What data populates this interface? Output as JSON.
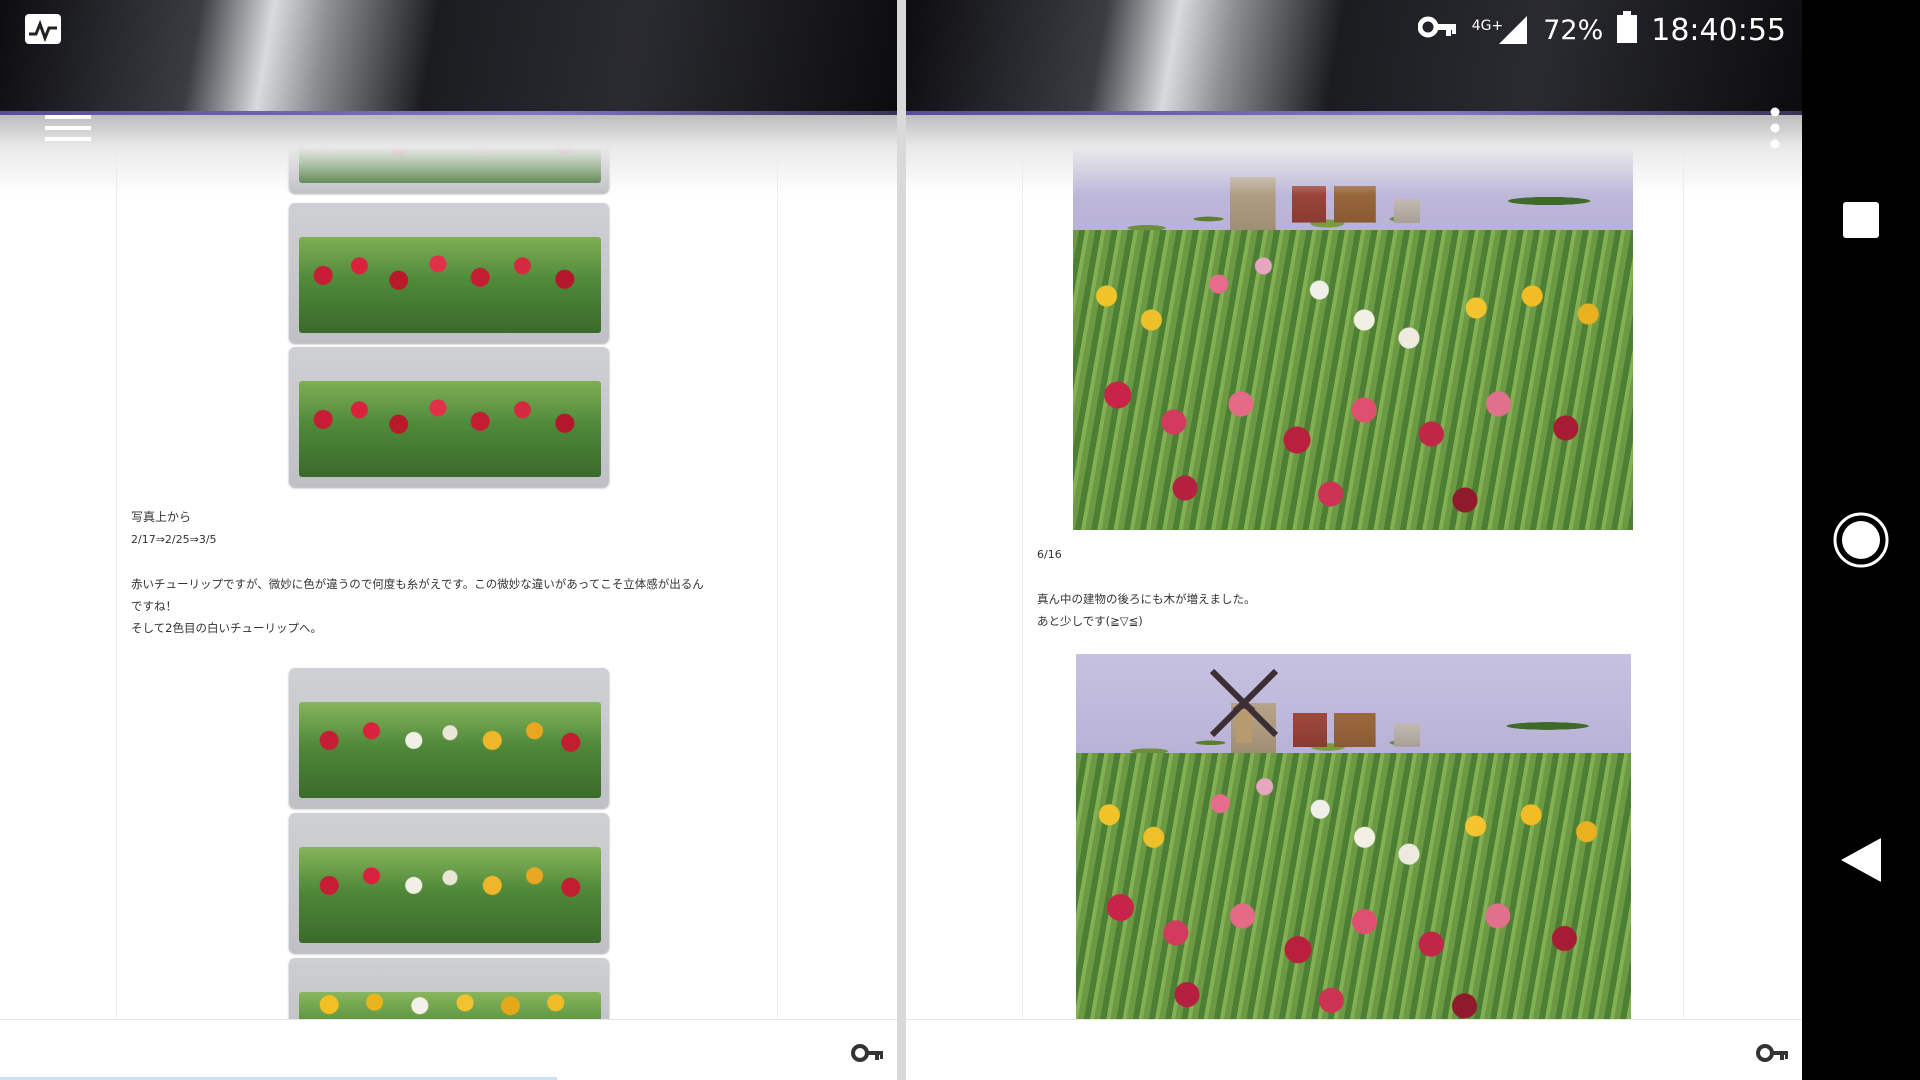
{
  "status_bar": {
    "network_label": "4G+",
    "battery": "72%",
    "time": "18:40:55",
    "icons": [
      "monitor-app-icon",
      "vpn-key-icon",
      "signal-icon",
      "battery-icon"
    ]
  },
  "left_pane": {
    "toolbar": {
      "menu_icon": "hamburger-menu-icon"
    },
    "caption": "写真上から",
    "dates": "2/17⇒2/25⇒3/5",
    "paragraph": "赤いチューリップですが、微妙に色が違うので何度も糸がえです。この微妙な違いがあってこそ立体感が出るん\nですね！\nそして2色目の白いチューリップへ。",
    "bottom_icon": "key-icon"
  },
  "right_pane": {
    "toolbar": {
      "more_icon": "more-vertical-icon"
    },
    "date": "6/16",
    "paragraph": "真ん中の建物の後ろにも木が増えました。\nあと少しです(≧▽≦)",
    "bottom_icon": "key-icon"
  },
  "nav_bar": {
    "items": [
      "recents-square-icon",
      "home-circle-icon",
      "back-triangle-icon"
    ]
  },
  "colors": {
    "nav_background": "#000000",
    "page_background": "#ffffff",
    "header_accent": "#8474c8"
  }
}
